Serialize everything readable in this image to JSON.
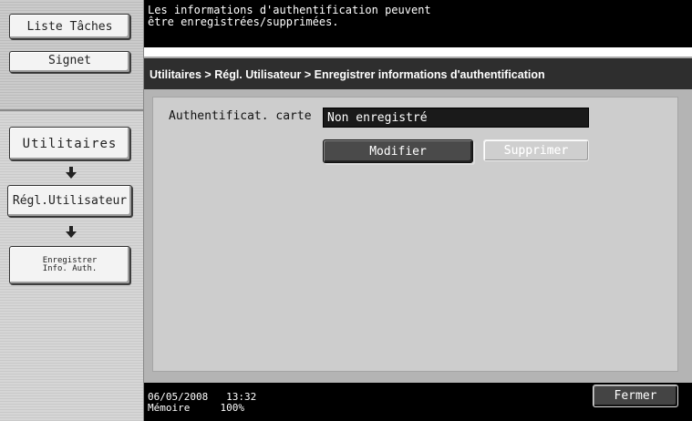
{
  "sidebar": {
    "liste_taches": "Liste Tâches",
    "signet": "Signet",
    "nav": [
      {
        "label": "Utilitaires"
      },
      {
        "label": "Régl.Utilisateur"
      },
      {
        "label_line1": "Enregistrer",
        "label_line2": "Info. Auth."
      }
    ]
  },
  "message": {
    "line1": "Les informations d'authentification peuvent",
    "line2": "être enregistrées/supprimées."
  },
  "breadcrumb": "Utilitaires > Régl. Utilisateur > Enregistrer informations d'authentification",
  "auth": {
    "label": "Authentificat. carte",
    "value": "Non enregistré",
    "modifier": "Modifier",
    "supprimer": "Supprimer"
  },
  "status": {
    "date": "06/05/2008",
    "time": "13:32",
    "memory_label": "Mémoire",
    "memory_value": "100%"
  },
  "fermer": "Fermer"
}
